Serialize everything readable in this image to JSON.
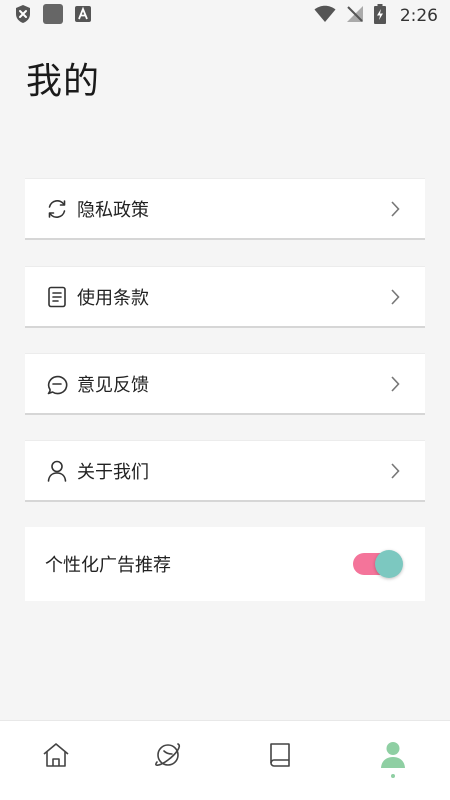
{
  "status_bar": {
    "time": "2:26",
    "icons": [
      "shield-x-icon",
      "app-square-icon",
      "font-a-icon",
      "wifi-icon",
      "no-signal-icon",
      "battery-charging-icon"
    ]
  },
  "page": {
    "title": "我的"
  },
  "menu": {
    "items": [
      {
        "label": "隐私政策",
        "icon": "refresh-icon"
      },
      {
        "label": "使用条款",
        "icon": "document-icon"
      },
      {
        "label": "意见反馈",
        "icon": "chat-bubble-icon"
      },
      {
        "label": "关于我们",
        "icon": "person-icon"
      }
    ]
  },
  "ad_toggle": {
    "label": "个性化广告推荐",
    "enabled": true
  },
  "bottom_nav": {
    "items": [
      {
        "name": "home",
        "icon": "home-icon"
      },
      {
        "name": "explore",
        "icon": "planet-icon"
      },
      {
        "name": "library",
        "icon": "book-icon"
      },
      {
        "name": "profile",
        "icon": "person-icon",
        "active": true
      }
    ]
  },
  "colors": {
    "toggle_track": "#f4749a",
    "toggle_thumb": "#7cc8c0",
    "nav_active": "#8fcfa3",
    "background": "#f5f5f5"
  }
}
